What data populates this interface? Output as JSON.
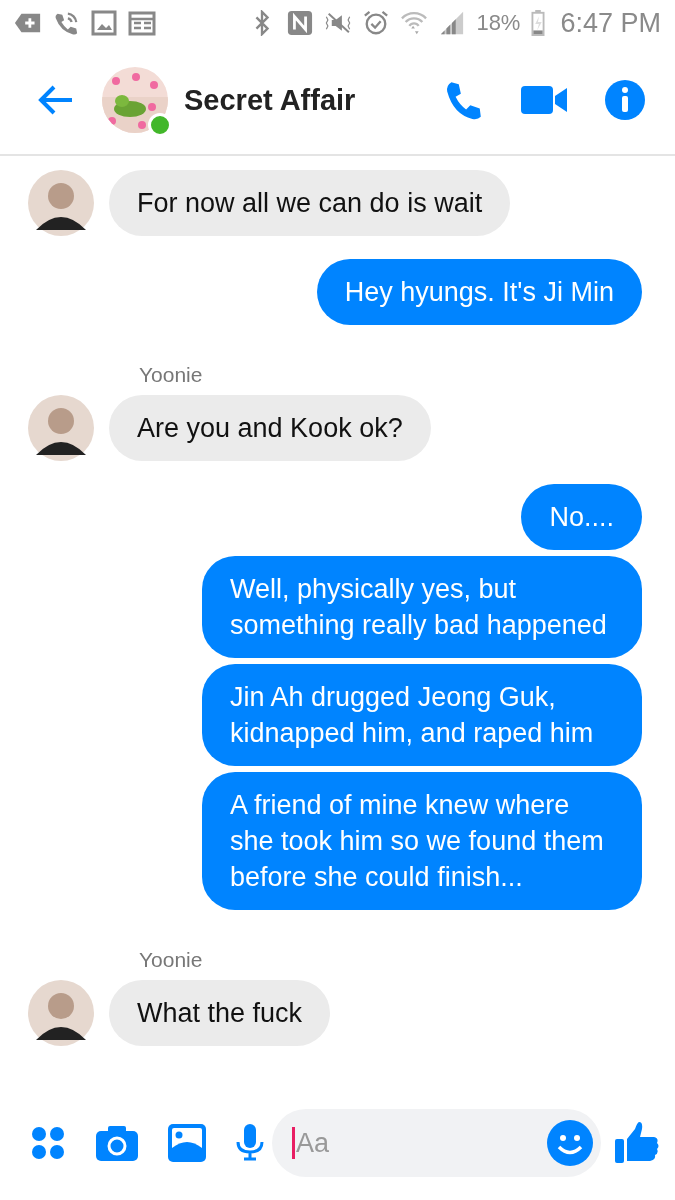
{
  "status_bar": {
    "battery": "18%",
    "time": "6:47 PM"
  },
  "header": {
    "title": "Secret Affair",
    "online": true
  },
  "messages": [
    {
      "kind": "incoming",
      "text": "For now all we can do is wait",
      "avatar": true
    },
    {
      "kind": "outgoing",
      "text": "Hey hyungs. It's Ji Min"
    },
    {
      "kind": "sender",
      "text": "Yoonie"
    },
    {
      "kind": "incoming",
      "text": "Are you and Kook ok?",
      "avatar": true
    },
    {
      "kind": "outgoing",
      "text": "No...."
    },
    {
      "kind": "outgoing",
      "text": "Well, physically yes, but something really bad happened"
    },
    {
      "kind": "outgoing",
      "text": "Jin Ah drugged Jeong Guk, kidnapped him, and raped him"
    },
    {
      "kind": "outgoing",
      "text": "A friend of mine knew where she took him so we found them before she could finish..."
    },
    {
      "kind": "sender",
      "text": "Yoonie"
    },
    {
      "kind": "incoming",
      "text": "What the fuck",
      "avatar": true
    }
  ],
  "composer": {
    "placeholder": "Aa"
  }
}
